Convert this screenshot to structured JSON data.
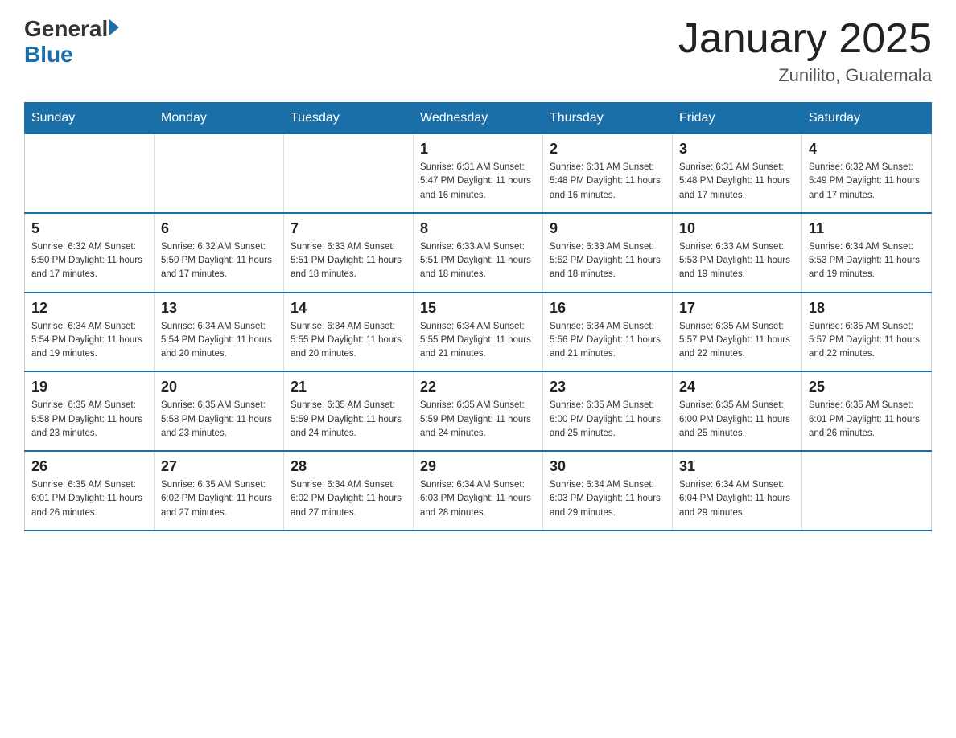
{
  "header": {
    "logo_general": "General",
    "logo_blue": "Blue",
    "title": "January 2025",
    "subtitle": "Zunilito, Guatemala"
  },
  "days_of_week": [
    "Sunday",
    "Monday",
    "Tuesday",
    "Wednesday",
    "Thursday",
    "Friday",
    "Saturday"
  ],
  "weeks": [
    [
      {
        "day": "",
        "info": ""
      },
      {
        "day": "",
        "info": ""
      },
      {
        "day": "",
        "info": ""
      },
      {
        "day": "1",
        "info": "Sunrise: 6:31 AM\nSunset: 5:47 PM\nDaylight: 11 hours\nand 16 minutes."
      },
      {
        "day": "2",
        "info": "Sunrise: 6:31 AM\nSunset: 5:48 PM\nDaylight: 11 hours\nand 16 minutes."
      },
      {
        "day": "3",
        "info": "Sunrise: 6:31 AM\nSunset: 5:48 PM\nDaylight: 11 hours\nand 17 minutes."
      },
      {
        "day": "4",
        "info": "Sunrise: 6:32 AM\nSunset: 5:49 PM\nDaylight: 11 hours\nand 17 minutes."
      }
    ],
    [
      {
        "day": "5",
        "info": "Sunrise: 6:32 AM\nSunset: 5:50 PM\nDaylight: 11 hours\nand 17 minutes."
      },
      {
        "day": "6",
        "info": "Sunrise: 6:32 AM\nSunset: 5:50 PM\nDaylight: 11 hours\nand 17 minutes."
      },
      {
        "day": "7",
        "info": "Sunrise: 6:33 AM\nSunset: 5:51 PM\nDaylight: 11 hours\nand 18 minutes."
      },
      {
        "day": "8",
        "info": "Sunrise: 6:33 AM\nSunset: 5:51 PM\nDaylight: 11 hours\nand 18 minutes."
      },
      {
        "day": "9",
        "info": "Sunrise: 6:33 AM\nSunset: 5:52 PM\nDaylight: 11 hours\nand 18 minutes."
      },
      {
        "day": "10",
        "info": "Sunrise: 6:33 AM\nSunset: 5:53 PM\nDaylight: 11 hours\nand 19 minutes."
      },
      {
        "day": "11",
        "info": "Sunrise: 6:34 AM\nSunset: 5:53 PM\nDaylight: 11 hours\nand 19 minutes."
      }
    ],
    [
      {
        "day": "12",
        "info": "Sunrise: 6:34 AM\nSunset: 5:54 PM\nDaylight: 11 hours\nand 19 minutes."
      },
      {
        "day": "13",
        "info": "Sunrise: 6:34 AM\nSunset: 5:54 PM\nDaylight: 11 hours\nand 20 minutes."
      },
      {
        "day": "14",
        "info": "Sunrise: 6:34 AM\nSunset: 5:55 PM\nDaylight: 11 hours\nand 20 minutes."
      },
      {
        "day": "15",
        "info": "Sunrise: 6:34 AM\nSunset: 5:55 PM\nDaylight: 11 hours\nand 21 minutes."
      },
      {
        "day": "16",
        "info": "Sunrise: 6:34 AM\nSunset: 5:56 PM\nDaylight: 11 hours\nand 21 minutes."
      },
      {
        "day": "17",
        "info": "Sunrise: 6:35 AM\nSunset: 5:57 PM\nDaylight: 11 hours\nand 22 minutes."
      },
      {
        "day": "18",
        "info": "Sunrise: 6:35 AM\nSunset: 5:57 PM\nDaylight: 11 hours\nand 22 minutes."
      }
    ],
    [
      {
        "day": "19",
        "info": "Sunrise: 6:35 AM\nSunset: 5:58 PM\nDaylight: 11 hours\nand 23 minutes."
      },
      {
        "day": "20",
        "info": "Sunrise: 6:35 AM\nSunset: 5:58 PM\nDaylight: 11 hours\nand 23 minutes."
      },
      {
        "day": "21",
        "info": "Sunrise: 6:35 AM\nSunset: 5:59 PM\nDaylight: 11 hours\nand 24 minutes."
      },
      {
        "day": "22",
        "info": "Sunrise: 6:35 AM\nSunset: 5:59 PM\nDaylight: 11 hours\nand 24 minutes."
      },
      {
        "day": "23",
        "info": "Sunrise: 6:35 AM\nSunset: 6:00 PM\nDaylight: 11 hours\nand 25 minutes."
      },
      {
        "day": "24",
        "info": "Sunrise: 6:35 AM\nSunset: 6:00 PM\nDaylight: 11 hours\nand 25 minutes."
      },
      {
        "day": "25",
        "info": "Sunrise: 6:35 AM\nSunset: 6:01 PM\nDaylight: 11 hours\nand 26 minutes."
      }
    ],
    [
      {
        "day": "26",
        "info": "Sunrise: 6:35 AM\nSunset: 6:01 PM\nDaylight: 11 hours\nand 26 minutes."
      },
      {
        "day": "27",
        "info": "Sunrise: 6:35 AM\nSunset: 6:02 PM\nDaylight: 11 hours\nand 27 minutes."
      },
      {
        "day": "28",
        "info": "Sunrise: 6:34 AM\nSunset: 6:02 PM\nDaylight: 11 hours\nand 27 minutes."
      },
      {
        "day": "29",
        "info": "Sunrise: 6:34 AM\nSunset: 6:03 PM\nDaylight: 11 hours\nand 28 minutes."
      },
      {
        "day": "30",
        "info": "Sunrise: 6:34 AM\nSunset: 6:03 PM\nDaylight: 11 hours\nand 29 minutes."
      },
      {
        "day": "31",
        "info": "Sunrise: 6:34 AM\nSunset: 6:04 PM\nDaylight: 11 hours\nand 29 minutes."
      },
      {
        "day": "",
        "info": ""
      }
    ]
  ]
}
